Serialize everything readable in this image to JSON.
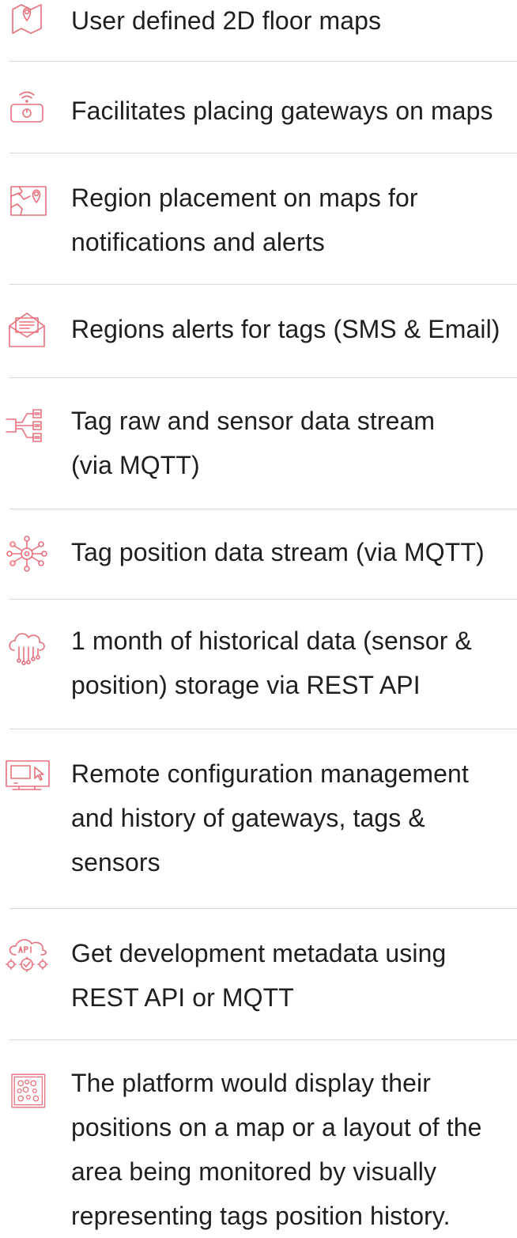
{
  "accent_color": "#e8717d",
  "features": [
    {
      "icon": "map-pin-icon",
      "text": "User defined 2D floor maps"
    },
    {
      "icon": "wifi-gateway-icon",
      "text": "Facilitates placing gateways on maps"
    },
    {
      "icon": "region-map-icon",
      "text": "Region placement on maps for notifications and alerts"
    },
    {
      "icon": "email-alert-icon",
      "text": "Regions alerts for tags (SMS & Email)"
    },
    {
      "icon": "data-stream-icon",
      "text": "Tag raw and sensor data stream (via MQTT)"
    },
    {
      "icon": "network-eye-icon",
      "text": "Tag position data stream (via MQTT)"
    },
    {
      "icon": "cloud-storage-icon",
      "text": "1 month of historical data (sensor & position) storage via REST API"
    },
    {
      "icon": "monitor-cursor-icon",
      "text": "Remote configuration management and history of gateways, tags & sensors"
    },
    {
      "icon": "api-cloud-gears-icon",
      "text": "Get development metadata using REST API or MQTT"
    },
    {
      "icon": "position-grid-icon",
      "text": "The platform would display their positions on a map or a layout of the area being monitored by visually representing tags position history."
    }
  ]
}
